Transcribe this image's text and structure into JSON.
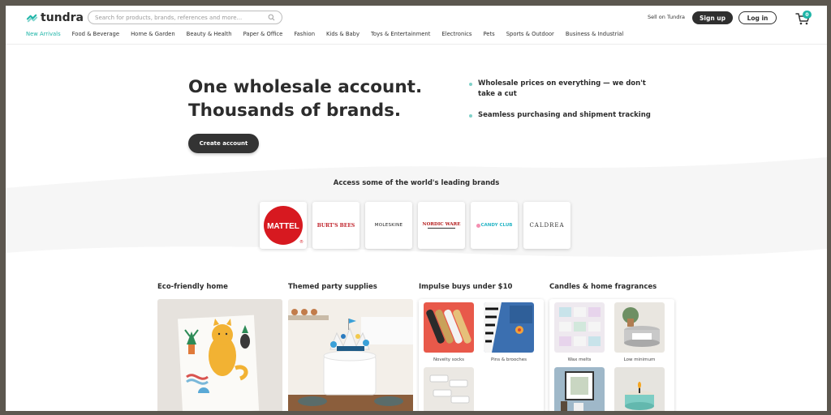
{
  "brand": {
    "name": "tundra"
  },
  "search": {
    "placeholder": "Search for products, brands, references and more..."
  },
  "header": {
    "sell_link": "Sell on Tundra",
    "signup": "Sign up",
    "login": "Log in",
    "cart_count": "0"
  },
  "nav": {
    "items": [
      "New Arrivals",
      "Food & Beverage",
      "Home & Garden",
      "Beauty & Health",
      "Paper & Office",
      "Fashion",
      "Kids & Baby",
      "Toys & Entertainment",
      "Electronics",
      "Pets",
      "Sports & Outdoor",
      "Business & Industrial"
    ]
  },
  "hero": {
    "line1": "One wholesale account.",
    "line2": "Thousands of brands.",
    "cta": "Create account",
    "bullet1": "Wholesale prices on everything — we don't take a cut",
    "bullet2": "Seamless purchasing and shipment tracking"
  },
  "brands_section": {
    "title": "Access some of the world's leading brands",
    "logos": [
      "MATTEL",
      "BURT'S BEES",
      "MOLESKINE",
      "NORDIC WARE",
      "CANDY CLUB",
      "CALDREA"
    ]
  },
  "categories": [
    {
      "title": "Eco-friendly home"
    },
    {
      "title": "Themed party supplies"
    },
    {
      "title": "Impulse buys under $10",
      "tiles": [
        "Novelty socks",
        "Pins & brooches",
        ""
      ]
    },
    {
      "title": "Candles & home fragrances",
      "tiles": [
        "Wax melts",
        "Low minimum",
        "",
        ""
      ]
    }
  ],
  "colors": {
    "accent": "#1fb5a8",
    "dark": "#2f2f2f"
  }
}
